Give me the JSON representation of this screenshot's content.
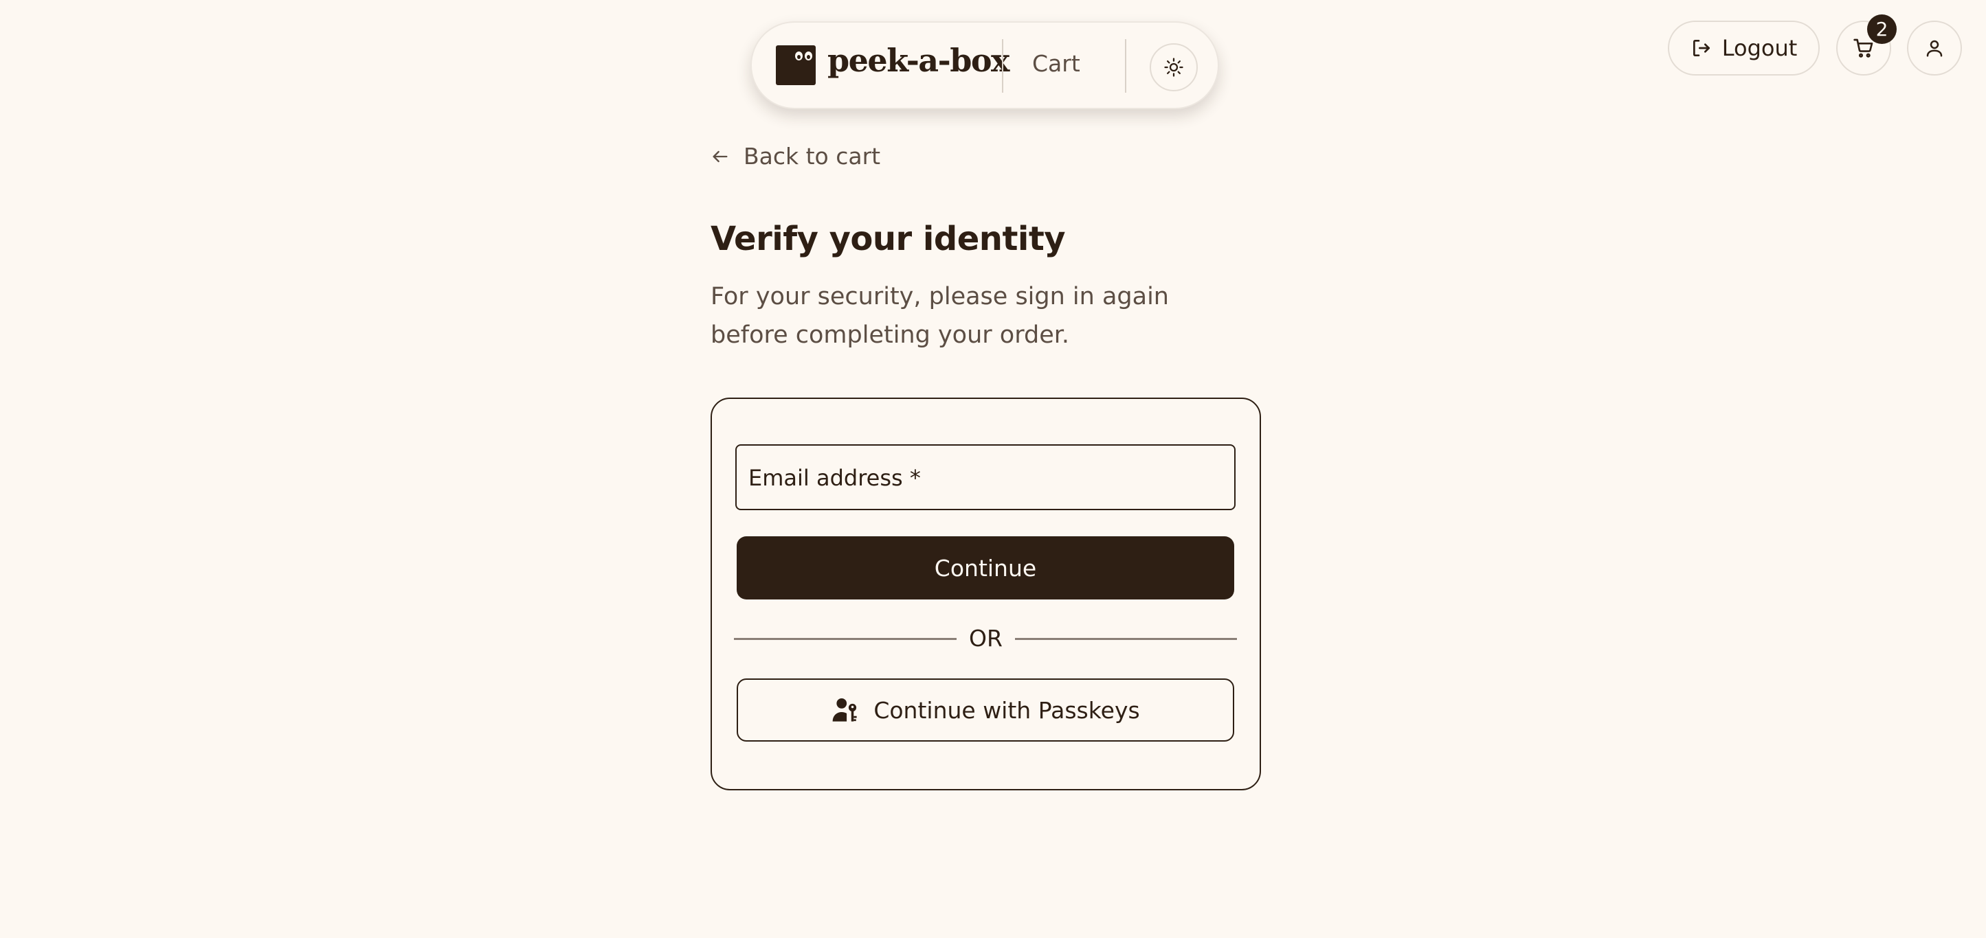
{
  "header": {
    "logo_text": "peek-a-box",
    "nav_cart_label": "Cart",
    "logout_label": "Logout",
    "cart_count": "2"
  },
  "main": {
    "back_link": "Back to cart",
    "title": "Verify your identity",
    "subtitle": "For your security, please sign in again before completing your order.",
    "form": {
      "email_label": "Email address *",
      "continue_label": "Continue",
      "divider_text": "OR",
      "passkeys_label": "Continue with Passkeys"
    }
  },
  "colors": {
    "background": "#fdf8f2",
    "primary": "#2e1f14",
    "muted_text": "#5c4e44"
  },
  "icons": {
    "theme": "sun-icon",
    "logout": "logout-icon",
    "cart": "cart-icon",
    "user": "user-icon",
    "back": "arrow-left-icon",
    "passkey": "passkey-icon"
  }
}
